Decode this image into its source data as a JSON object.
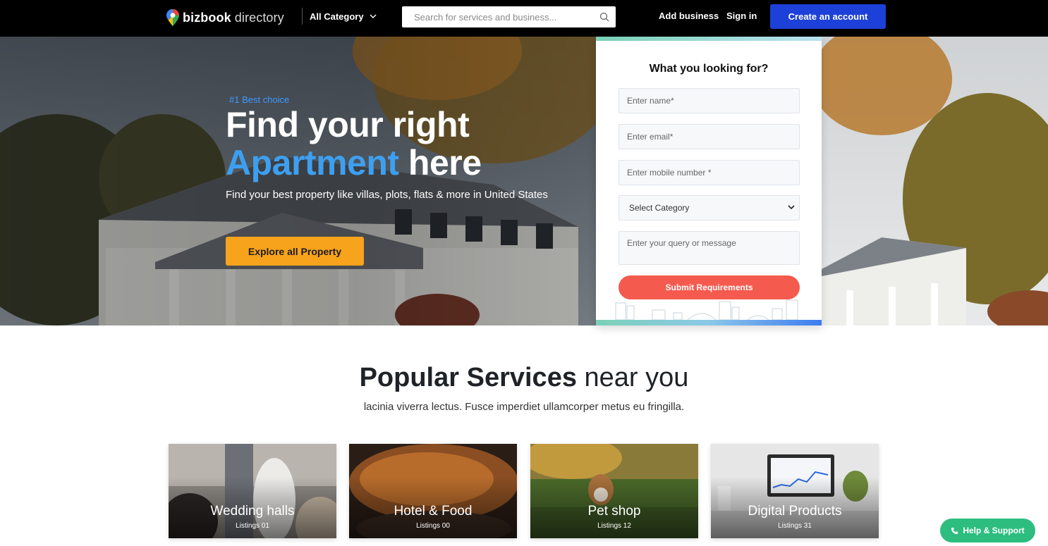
{
  "header": {
    "logo_bold": "bizbook",
    "logo_light": " directory",
    "category_label": "All Category",
    "search_placeholder": "Search for services and business...",
    "add_business": "Add business",
    "sign_in": "Sign in",
    "create_account": "Create an account"
  },
  "hero": {
    "badge": "#1 Best choice",
    "title_line1": "Find your right",
    "title_highlight": "Apartment",
    "title_rest": " here",
    "subtitle": "Find your best property like villas, plots, flats & more in United States",
    "cta": "Explore all Property"
  },
  "form": {
    "title": "What you looking for?",
    "name_placeholder": "Enter name*",
    "email_placeholder": "Enter email*",
    "mobile_placeholder": "Enter mobile number *",
    "category_selected": "Select Category",
    "message_placeholder": "Enter your query or message",
    "submit": "Submit Requirements"
  },
  "services": {
    "title_bold": "Popular Services",
    "title_light": " near you",
    "subtitle": "lacinia viverra lectus. Fusce imperdiet ullamcorper metus eu fringilla.",
    "cards": [
      {
        "title": "Wedding halls",
        "count": "Listings 01"
      },
      {
        "title": "Hotel & Food",
        "count": "Listings 00"
      },
      {
        "title": "Pet shop",
        "count": "Listings 12"
      },
      {
        "title": "Digital Products",
        "count": "Listings 31"
      }
    ]
  },
  "help": {
    "label": "Help & Support"
  },
  "colors": {
    "accent_blue": "#1d40d8",
    "highlight_blue": "#3d9ff0",
    "explore_orange": "#f8a31c",
    "submit_red": "#f55a4e",
    "help_green": "#2dbd7f"
  }
}
